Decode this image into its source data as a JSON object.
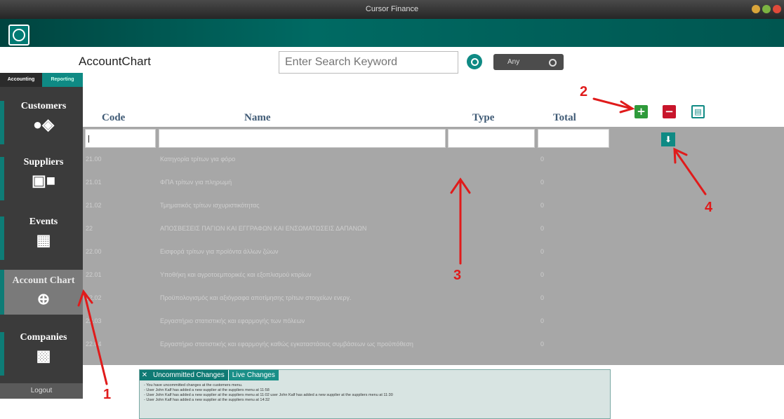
{
  "window": {
    "title": "Cursor Finance"
  },
  "header": {
    "page_title": "AccountChart"
  },
  "search": {
    "placeholder": "Enter Search Keyword",
    "scope_label": "Any"
  },
  "sidebar": {
    "tabs": [
      "Accounting",
      "Reporting"
    ],
    "items": [
      {
        "label": "Customers",
        "icon": "customers-icon"
      },
      {
        "label": "Suppliers",
        "icon": "truck-icon"
      },
      {
        "label": "Events",
        "icon": "calendar-icon"
      },
      {
        "label": "Account Chart",
        "icon": "account-chart-icon"
      },
      {
        "label": "Companies",
        "icon": "factory-icon"
      }
    ],
    "logout": "Logout"
  },
  "table": {
    "columns": [
      "Code",
      "Name",
      "Type",
      "Total"
    ],
    "filter_code_value": "|",
    "rows": [
      {
        "code": "21.00",
        "name": "Κατηγορία τρίτων για φόρο",
        "total": "0"
      },
      {
        "code": "21.01",
        "name": "ΦΠΑ τρίτων για πληρωμή",
        "total": "0"
      },
      {
        "code": "21.02",
        "name": "Τμηματικός τρίτων ισχυριστικότητας",
        "total": "0"
      },
      {
        "code": "22",
        "name": "ΑΠΟΣΒΕΣΕΙΣ ΠΑΓΙΩΝ ΚΑΙ ΕΓΓΡΑΦΩΝ ΚΑΙ ΕΝΣΩΜΑΤΩΣΕΙΣ ΔΑΠΑΝΩΝ",
        "total": "0"
      },
      {
        "code": "22.00",
        "name": "Εισφορά τρίτων για προϊόντα άλλων ζώων",
        "total": "0"
      },
      {
        "code": "22.01",
        "name": "Υποθήκη και αγροτοεμπορικές και εξοπλισμού κτιρίων",
        "total": "0"
      },
      {
        "code": "22.02",
        "name": "Προϋπολογισμός και αξιόγραφα αποτίμησης τρίτων στοιχείων ενεργ.",
        "total": "0"
      },
      {
        "code": "22.03",
        "name": "Εργαστήριο στατιστικής και εφαρμογής των πόλεων",
        "total": "0"
      },
      {
        "code": "22.04",
        "name": "Εργαστήριο στατιστικής και εφαρμογής καθώς εγκαταστάσεις συμβάσεων ως προϋπόθεση",
        "total": "0"
      }
    ]
  },
  "toolbar": {
    "add": "+",
    "remove": "−"
  },
  "changes_panel": {
    "tab_uncommitted": "Uncommitted Changes",
    "tab_live": "Live Changes",
    "lines": [
      "- You have uncommitted changes at the customers menu.",
      "- User John Kalf has added a new supplier at the suppliers menu at 11:58",
      "- User John Kalf has added a new supplier at the suppliers menu at 11:02 user John Kalf has added a new supplier at the suppliers menu at 11:30",
      "- User John Kalf has added a new supplier at the suppliers menu at 14:32"
    ]
  },
  "annotations": [
    "1",
    "2",
    "3",
    "4"
  ],
  "colors": {
    "accent": "#0f8a84",
    "arrow": "#e01b1b",
    "add": "#2e9a3a",
    "remove": "#c8152b"
  }
}
